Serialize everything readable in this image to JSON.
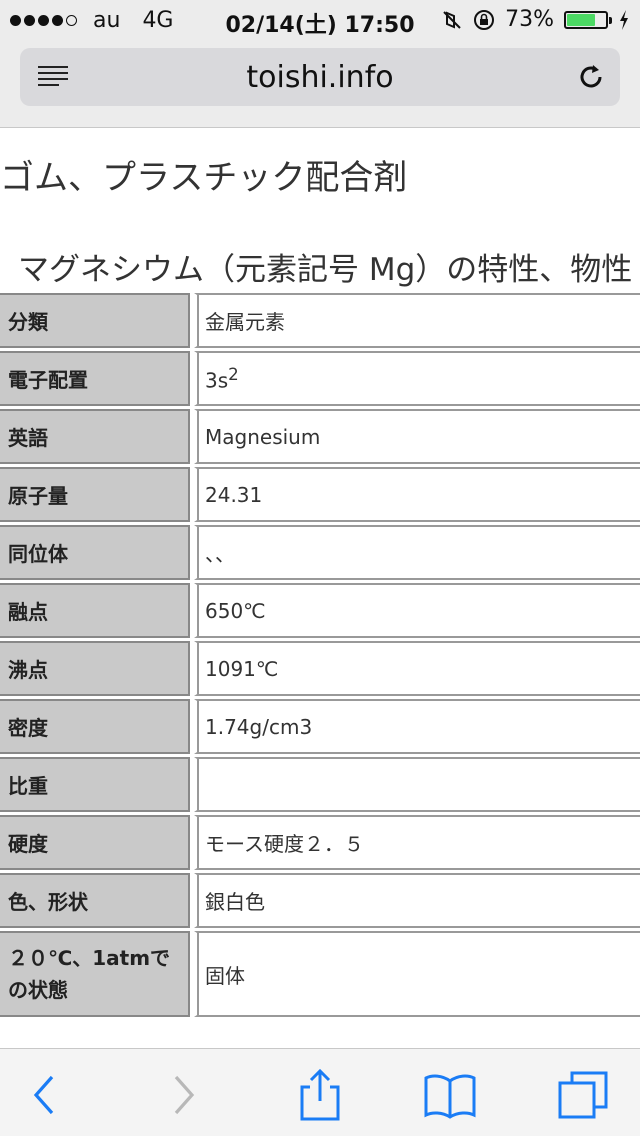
{
  "status_bar": {
    "carrier": "au",
    "network": "4G",
    "time": "02/14(土) 17:50",
    "battery_percent": "73%",
    "battery_level": 0.73,
    "battery_color": "#4cd964"
  },
  "browser": {
    "url": "toishi.info",
    "reader_icon": "reader-lines-icon",
    "reload_icon": "reload-icon"
  },
  "page": {
    "heading_usage": "ゴム、プラスチック配合剤",
    "heading_table": "マグネシウム（元素記号 Mg）の特性、物性",
    "table_rows": [
      {
        "label": "分類",
        "value": "金属元素"
      },
      {
        "label": "電子配置",
        "value": "3s",
        "value_sup": "2"
      },
      {
        "label": "英語",
        "value": "Magnesium"
      },
      {
        "label": "原子量",
        "value": "24.31"
      },
      {
        "label": "同位体",
        "value": "、、"
      },
      {
        "label": "融点",
        "value": "650℃"
      },
      {
        "label": "沸点",
        "value": "1091℃"
      },
      {
        "label": "密度",
        "value": "1.74g/cm3"
      },
      {
        "label": "比重",
        "value": ""
      },
      {
        "label": "硬度",
        "value": "モース硬度２．５"
      },
      {
        "label": "色、形状",
        "value": "銀白色"
      },
      {
        "label": "２０℃、1atmでの状態",
        "value": "固体"
      }
    ]
  },
  "toolbar": {
    "back_icon": "back-chevron-icon",
    "forward_icon": "forward-chevron-icon",
    "share_icon": "share-icon",
    "bookmarks_icon": "bookmarks-book-icon",
    "tabs_icon": "tabs-icon",
    "accent_color": "#1a7cf5"
  }
}
